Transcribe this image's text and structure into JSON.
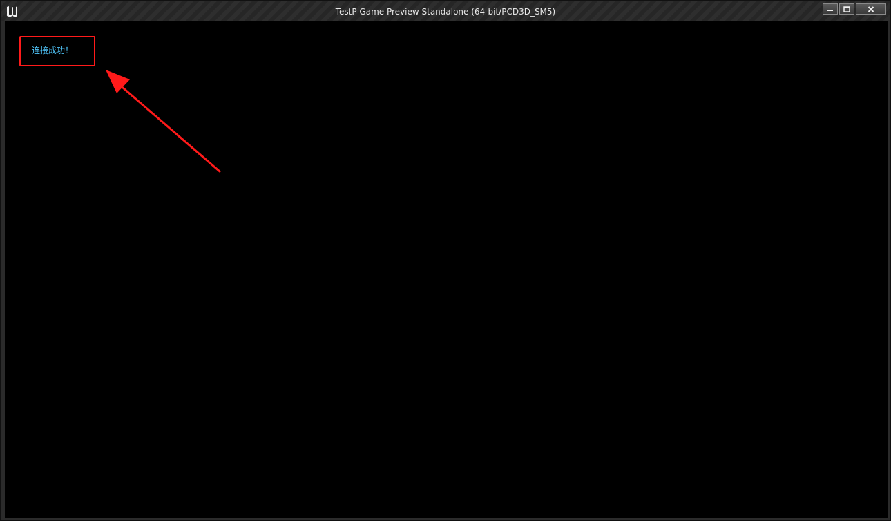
{
  "window": {
    "title": "TestP Game Preview Standalone (64-bit/PCD3D_SM5)",
    "logo_icon": "unreal-engine-logo-icon",
    "controls": {
      "minimize_icon": "minimize-icon",
      "maximize_icon": "maximize-icon",
      "close_icon": "close-icon"
    }
  },
  "viewport": {
    "status_message": "连接成功！",
    "status_color": "#4fc3f7"
  },
  "annotation": {
    "box_color": "#ff1a1a",
    "arrow_color": "#ff1a1a"
  }
}
